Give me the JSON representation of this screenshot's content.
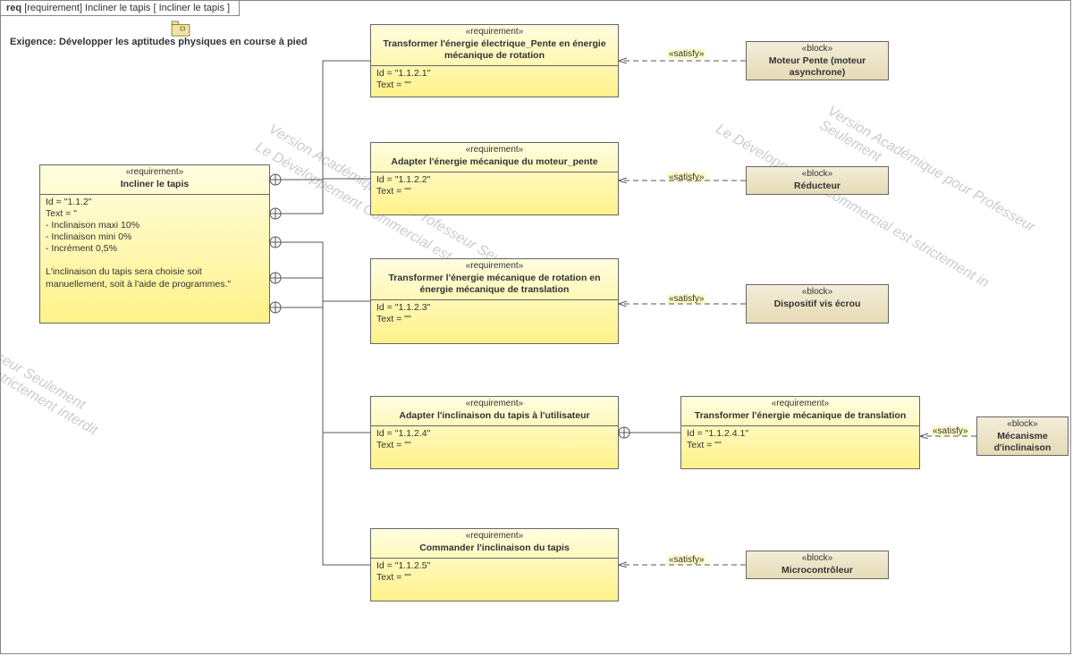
{
  "frame": {
    "kw": "req",
    "label": "[requirement] Incliner le tapis [ Incliner le tapis ]"
  },
  "exigence": "Exigence: Développer les aptitudes physiques en course à pied",
  "mainReq": {
    "stereo": "«requirement»",
    "title": "Incliner le tapis",
    "body": "Id = \"1.1.2\"\nText = \"\n- Inclinaison maxi 10%\n- Inclinaison mini 0%\n- Incrément 0,5%\n\nL'inclinaison du tapis sera choisie soit manuellement, soit à l'aide de programmes.\""
  },
  "childReqs": [
    {
      "stereo": "«requirement»",
      "title": "Transformer l'énergie électrique_Pente en énergie mécanique de rotation",
      "body": "Id = \"1.1.2.1\"\nText = \"\""
    },
    {
      "stereo": "«requirement»",
      "title": "Adapter l'énergie mécanique du moteur_pente",
      "body": "Id = \"1.1.2.2\"\nText = \"\""
    },
    {
      "stereo": "«requirement»",
      "title": "Transformer l'énergie mécanique de rotation en énergie mécanique de translation",
      "body": "Id = \"1.1.2.3\"\nText = \"\""
    },
    {
      "stereo": "«requirement»",
      "title": "Adapter l'inclinaison\ndu tapis à l'utilisateur",
      "body": "Id = \"1.1.2.4\"\nText = \"\""
    },
    {
      "stereo": "«requirement»",
      "title": "Commander l'inclinaison\ndu tapis",
      "body": "Id = \"1.1.2.5\"\nText = \"\""
    }
  ],
  "subReq4": {
    "stereo": "«requirement»",
    "title": "Transformer l'énergie mécanique de translation",
    "body": "Id = \"1.1.2.4.1\"\nText = \"\""
  },
  "blocks": [
    {
      "stereo": "«block»",
      "title": "Moteur Pente\n(moteur asynchrone)"
    },
    {
      "stereo": "«block»",
      "title": "Réducteur"
    },
    {
      "stereo": "«block»",
      "title": "Dispositif\nvis écrou"
    },
    {
      "stereo": "«block»",
      "title": "Mécanisme\nd'inclinaison"
    },
    {
      "stereo": "«block»",
      "title": "Microcontrôleur"
    }
  ],
  "satisfy": "«satisfy»",
  "watermarks": {
    "w1": "Version Académique pour Professeur Seulement",
    "w2": "Le Développement Commercial est strictement interdit",
    "w3": "seur Seulement",
    "w4": "t strictement interdit",
    "w5": "Version Académique pour Professeur Seulement",
    "w6": "Le Développement Commercial est strictement in"
  }
}
